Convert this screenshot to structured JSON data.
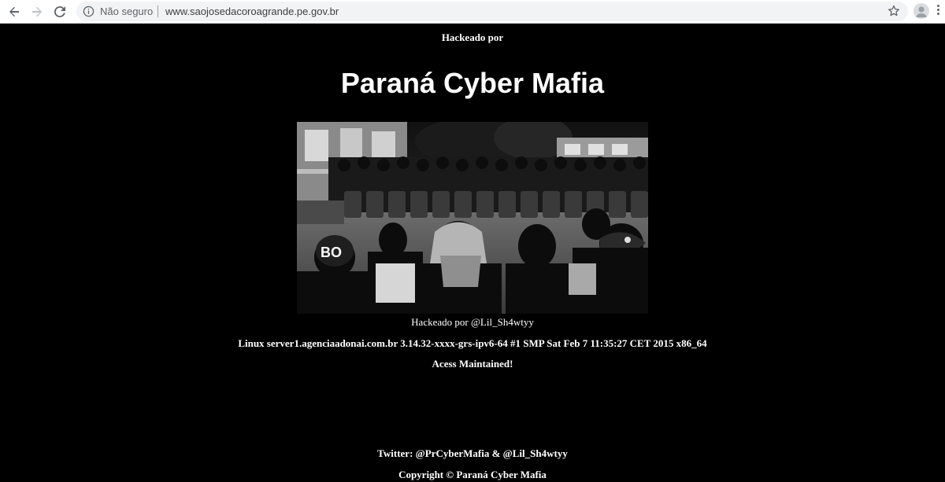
{
  "browser": {
    "security_label": "Não seguro",
    "url": "www.saojosedacoroagrande.pe.gov.br",
    "icons": {
      "back": "arrow-left-icon",
      "forward": "arrow-right-icon",
      "reload": "reload-icon",
      "info": "info-icon",
      "bookmark": "star-icon",
      "profile": "avatar-icon",
      "menu": "kebab-menu-icon"
    }
  },
  "page": {
    "hacked_by_label": "Hackeado por",
    "crew_name": "Paraná Cyber Mafia",
    "photo": {
      "lettering": "BO"
    },
    "hacked_by_handle": "Hackeado por @Lil_Sh4wtyy",
    "server_info": "Linux server1.agenciaadonai.com.br 3.14.32-xxxx-grs-ipv6-64 #1 SMP Sat Feb 7 11:35:27 CET 2015 x86_64",
    "access_message": "Acess Maintained!",
    "twitter": "Twitter: @PrCyberMafia & @Lil_Sh4wtyy",
    "copyright": "Copyright © Paraná Cyber Mafia"
  },
  "colors": {
    "page_background": "#000000",
    "page_text": "#ffffff",
    "chrome_background": "#ffffff",
    "omnibox_background": "#f1f3f4"
  }
}
